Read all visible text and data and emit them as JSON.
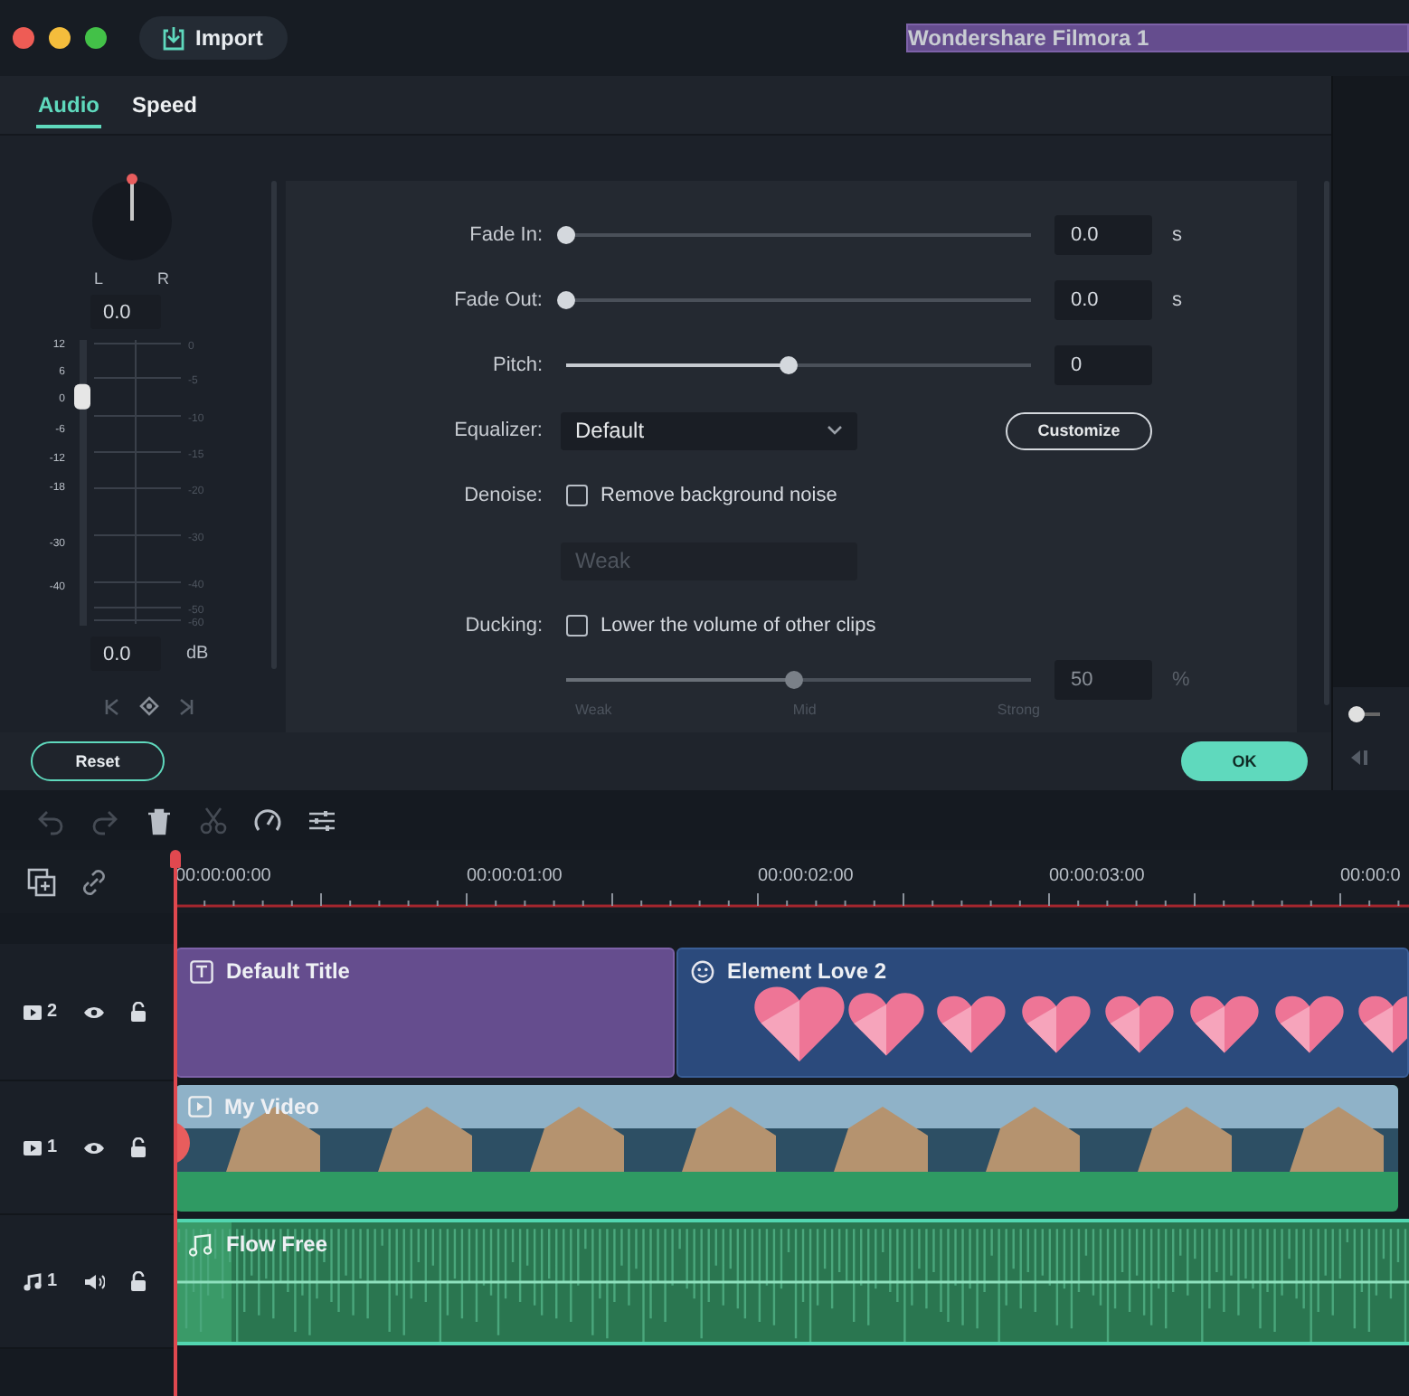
{
  "window": {
    "title": "Wondershare Filmora 1",
    "import_button": "Import"
  },
  "tabs": [
    {
      "label": "Audio",
      "selected": true
    },
    {
      "label": "Speed",
      "selected": false
    }
  ],
  "mixer": {
    "pan_labels": [
      "L",
      "R"
    ],
    "pan_value": "0.0",
    "left_scale": [
      "12",
      "6",
      "0",
      "-6",
      "-12",
      "-18",
      "-30",
      "-40"
    ],
    "right_scale": [
      "0",
      "-5",
      "-10",
      "-15",
      "-20",
      "-30",
      "-40",
      "-50",
      "-60"
    ],
    "level": 0.8,
    "volume_value": "0.0",
    "volume_unit": "dB"
  },
  "settings": [
    {
      "kind": "slider",
      "label": "Fade In:",
      "level": 0,
      "value": "0.0",
      "unit": "s",
      "disabled": false
    },
    {
      "kind": "slider",
      "label": "Fade Out:",
      "level": 0,
      "value": "0.0",
      "unit": "s",
      "disabled": false
    },
    {
      "kind": "slider",
      "label": "Pitch:",
      "level": 0.48,
      "value": "0",
      "disabled": false
    },
    {
      "kind": "dropdown",
      "label": "Equalizer:",
      "value": "Default",
      "button": "Customize",
      "disabled": false
    },
    {
      "kind": "checkbox",
      "label": "Denoise:",
      "text": "Remove background noise",
      "checked": false
    },
    {
      "kind": "dropdown",
      "value": "Weak",
      "disabled": true
    },
    {
      "kind": "checkbox",
      "label": "Ducking:",
      "text": "Lower the volume of other clips",
      "checked": false
    },
    {
      "kind": "slider",
      "level": 0.49,
      "value": "50",
      "unit": "%",
      "disabled": true,
      "marks": [
        "Weak",
        "Mid",
        "Strong"
      ]
    }
  ],
  "footer": {
    "reset": "Reset",
    "ok": "OK"
  },
  "toolbar": [
    {
      "kind": "undo",
      "disabled": true
    },
    {
      "kind": "redo",
      "disabled": true
    },
    {
      "kind": "delete",
      "disabled": false
    },
    {
      "kind": "cut",
      "disabled": true
    },
    {
      "kind": "speed",
      "disabled": false
    },
    {
      "kind": "adjust",
      "disabled": false
    }
  ],
  "timeline": {
    "timecodes": [
      "00:00:00:00",
      "00:00:01:00",
      "00:00:02:00",
      "00:00:03:00",
      "00:00:0"
    ],
    "tracks": [
      {
        "kind": "video",
        "number": "2",
        "clips": [
          {
            "kind": "title",
            "label": "Default Title"
          },
          {
            "kind": "element",
            "label": "Element Love 2"
          }
        ]
      },
      {
        "kind": "video",
        "number": "1",
        "clips": [
          {
            "kind": "video",
            "label": "My Video"
          }
        ]
      },
      {
        "kind": "audio",
        "number": "1",
        "clips": [
          {
            "kind": "audio",
            "label": "Flow Free"
          }
        ]
      }
    ]
  }
}
